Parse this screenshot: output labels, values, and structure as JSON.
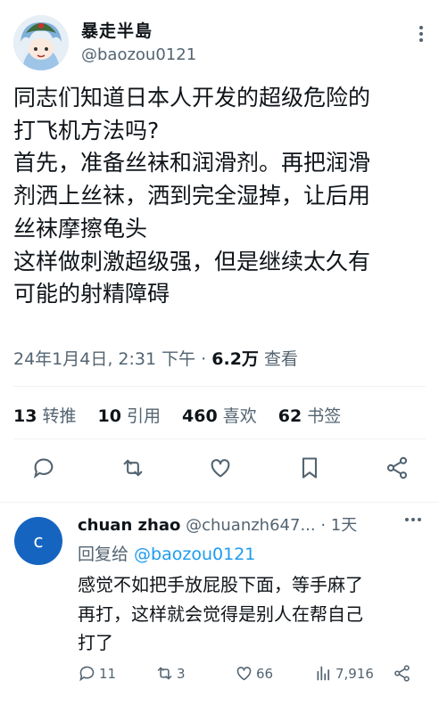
{
  "tweet": {
    "author_name": "暴走半島",
    "author_handle": "@baozou0121",
    "lines": [
      "同志们知道日本人开发的超级危险的",
      "打飞机方法吗?",
      "首先，准备丝袜和润滑剂。再把润滑",
      "剂洒上丝袜，洒到完全湿掉，让后用",
      "丝袜摩擦龟头",
      "这样做刺激超级强，但是继续太久有",
      "可能的射精障碍"
    ],
    "timestamp": "24年1月4日, 2:31 下午",
    "separator": " · ",
    "views_count": "6.2万",
    "views_label": " 查看",
    "stats": [
      {
        "count": "13",
        "label": "转推"
      },
      {
        "count": "10",
        "label": "引用"
      },
      {
        "count": "460",
        "label": "喜欢"
      },
      {
        "count": "62",
        "label": "书签"
      }
    ]
  },
  "reply": {
    "avatar_letter": "c",
    "name": "chuan zhao",
    "handle": "@chuanzh647...",
    "separator": " · ",
    "time": "1天",
    "replying_prefix": "回复给 ",
    "replying_handle": "@baozou0121",
    "lines": [
      "感觉不如把手放屁股下面，等手麻了",
      "再打，这样就会觉得是别人在帮自己",
      "打了"
    ],
    "replies": "11",
    "retweets": "3",
    "likes": "66",
    "views": "7,916"
  },
  "colors": {
    "accent": "#1d9bf0",
    "muted": "#536471",
    "avatar_reply": "#1565c0"
  }
}
